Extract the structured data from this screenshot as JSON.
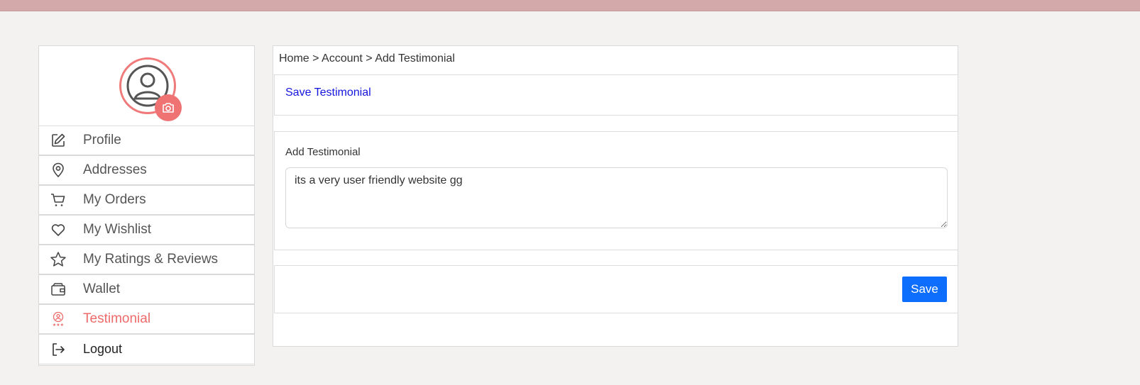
{
  "colors": {
    "topbar": "#d3aaa9",
    "accent": "#ef7373",
    "link": "#1515e0",
    "primary_button": "#0d6efd"
  },
  "profile": {
    "avatar_icon": "user-circle-icon",
    "camera_icon": "camera-icon"
  },
  "sidebar": {
    "items": [
      {
        "label": "Profile",
        "icon": "edit-icon",
        "active": false
      },
      {
        "label": "Addresses",
        "icon": "map-pin-icon",
        "active": false
      },
      {
        "label": "My Orders",
        "icon": "cart-icon",
        "active": false
      },
      {
        "label": "My Wishlist",
        "icon": "heart-icon",
        "active": false
      },
      {
        "label": "My Ratings & Reviews",
        "icon": "star-icon",
        "active": false
      },
      {
        "label": "Wallet",
        "icon": "wallet-icon",
        "active": false
      },
      {
        "label": "Testimonial",
        "icon": "testimonial-icon",
        "active": true
      },
      {
        "label": "Logout",
        "icon": "logout-icon",
        "active": false
      }
    ]
  },
  "breadcrumb": "Home > Account > Add Testimonial",
  "header": {
    "title": "Save Testimonial"
  },
  "form": {
    "label": "Add Testimonial",
    "value": "its a very user friendly website gg"
  },
  "footer": {
    "save_label": "Save"
  }
}
